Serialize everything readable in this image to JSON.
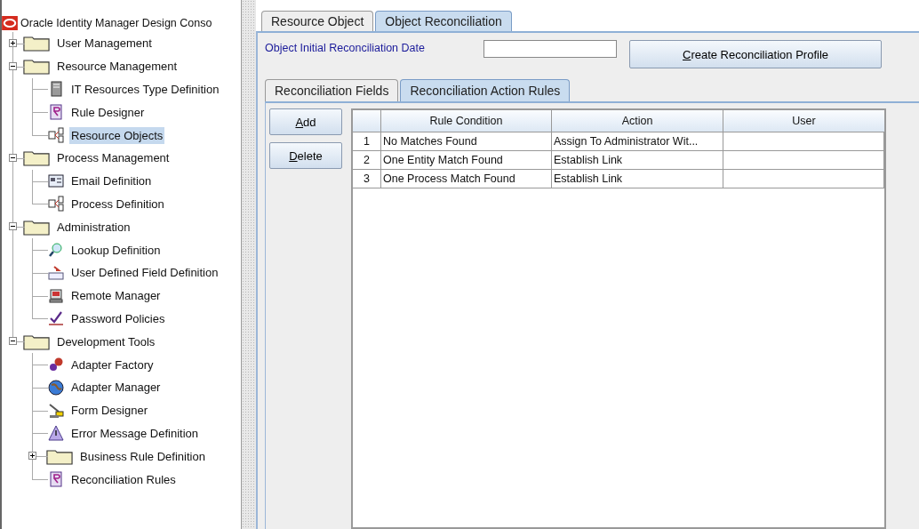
{
  "window": {
    "title": "Oracle Identity Manager Design Conso"
  },
  "tree": [
    {
      "label": "User Management",
      "kind": "folder",
      "expanded": false,
      "selected": false
    },
    {
      "label": "Resource Management",
      "kind": "folder",
      "expanded": true,
      "selected": false,
      "children": [
        {
          "label": "IT Resources Type Definition",
          "kind": "leaf",
          "selected": false
        },
        {
          "label": "Rule Designer",
          "kind": "leaf",
          "selected": false
        },
        {
          "label": "Resource Objects",
          "kind": "leaf",
          "selected": true
        }
      ]
    },
    {
      "label": "Process Management",
      "kind": "folder",
      "expanded": true,
      "selected": false,
      "children": [
        {
          "label": "Email Definition",
          "kind": "leaf",
          "selected": false
        },
        {
          "label": "Process Definition",
          "kind": "leaf",
          "selected": false
        }
      ]
    },
    {
      "label": "Administration",
      "kind": "folder",
      "expanded": true,
      "selected": false,
      "children": [
        {
          "label": "Lookup Definition",
          "kind": "leaf",
          "selected": false
        },
        {
          "label": "User Defined Field Definition",
          "kind": "leaf",
          "selected": false
        },
        {
          "label": "Remote Manager",
          "kind": "leaf",
          "selected": false
        },
        {
          "label": "Password Policies",
          "kind": "leaf",
          "selected": false
        }
      ]
    },
    {
      "label": "Development Tools",
      "kind": "folder",
      "expanded": true,
      "selected": false,
      "children": [
        {
          "label": "Adapter Factory",
          "kind": "leaf",
          "selected": false
        },
        {
          "label": "Adapter Manager",
          "kind": "leaf",
          "selected": false
        },
        {
          "label": "Form Designer",
          "kind": "leaf",
          "selected": false
        },
        {
          "label": "Error Message Definition",
          "kind": "leaf",
          "selected": false
        },
        {
          "label": "Business Rule Definition",
          "kind": "folder",
          "expanded": false,
          "selected": false
        },
        {
          "label": "Reconciliation Rules",
          "kind": "leaf",
          "selected": false
        }
      ]
    }
  ],
  "tabs": [
    {
      "label": "Resource Object",
      "selected": false
    },
    {
      "label": "Object Reconciliation",
      "selected": true
    }
  ],
  "form": {
    "label": "Object Initial Reconciliation Date",
    "button": "Create Reconciliation Profile"
  },
  "subtabs": [
    {
      "label": "Reconciliation Fields",
      "selected": false
    },
    {
      "label": "Reconciliation Action Rules",
      "selected": true
    }
  ],
  "buttons": [
    "Add",
    "Delete"
  ],
  "table": {
    "columns": [
      "Rule Condition",
      "Action",
      "User"
    ],
    "rows": [
      {
        "number": "1",
        "condition": "No Matches Found",
        "action": "Assign To Administrator Wit..."
      },
      {
        "number": "2",
        "condition": "One Entity Match Found",
        "action": "Establish Link"
      },
      {
        "number": "3",
        "condition": "One Process Match Found",
        "action": "Establish Link"
      }
    ]
  }
}
